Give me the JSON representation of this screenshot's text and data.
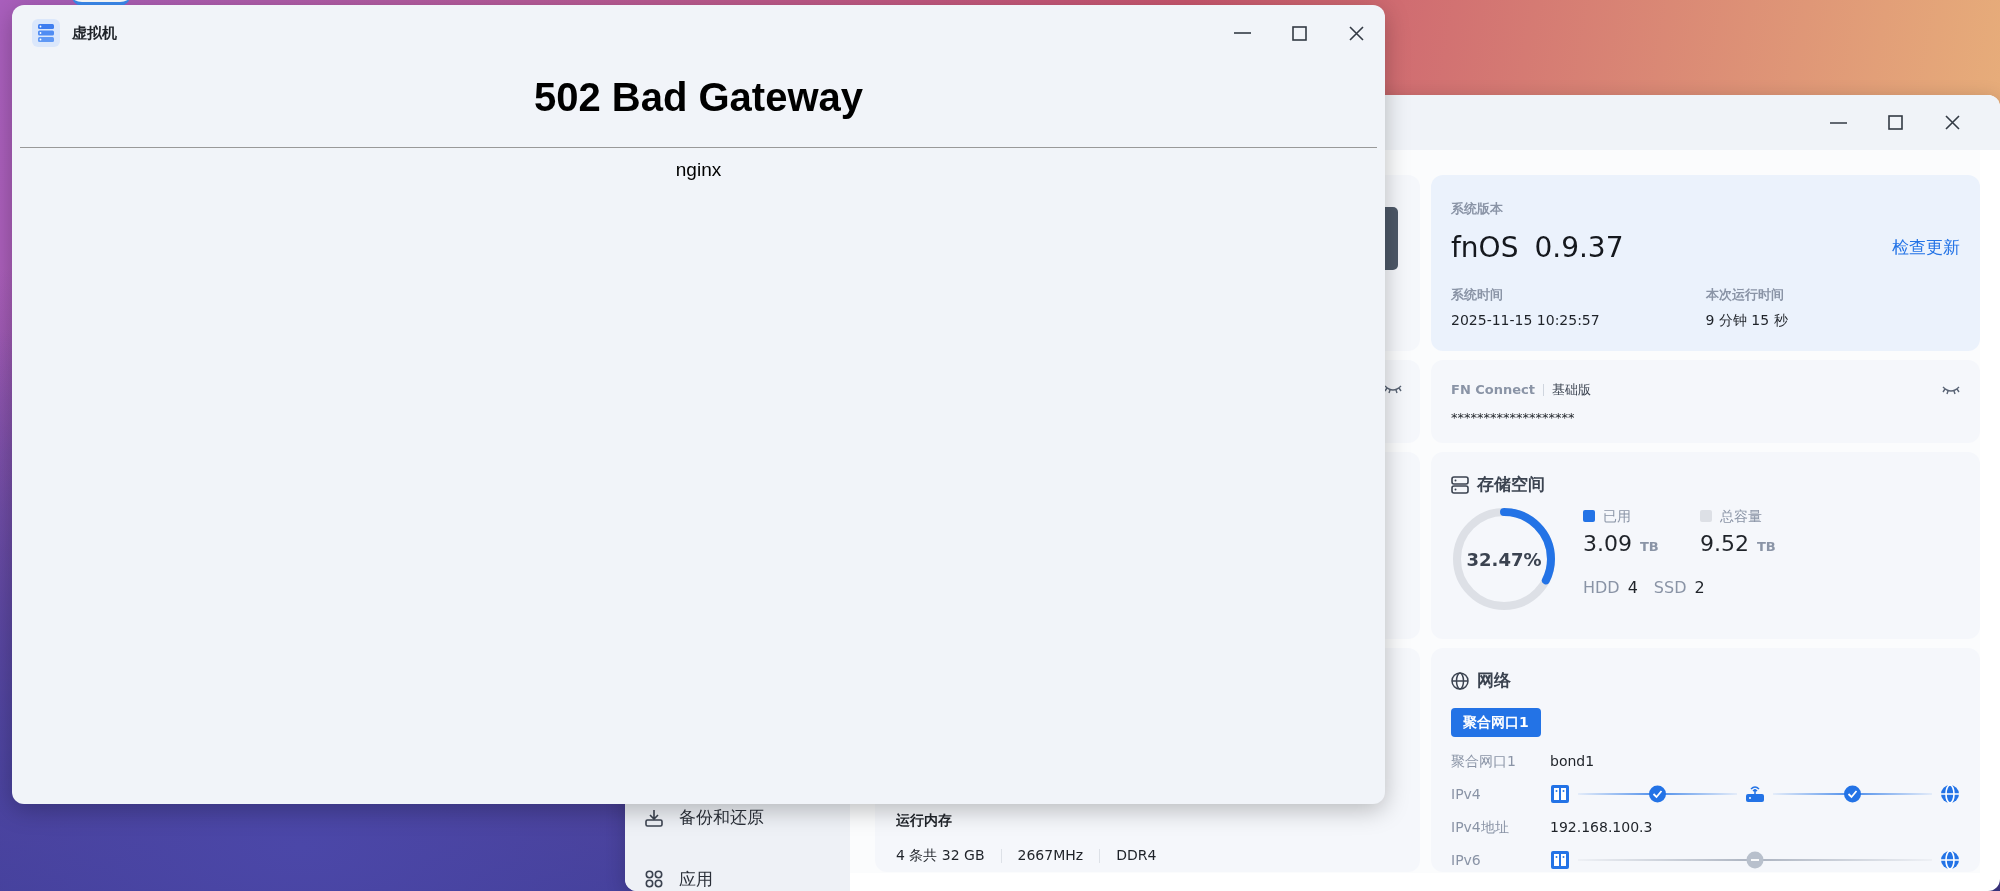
{
  "back_window": {
    "sidebar": [
      {
        "label": "备份和还原"
      },
      {
        "label": "应用"
      }
    ],
    "memory": {
      "title": "运行内存",
      "specs": [
        "4 条共 32 GB",
        "2667MHz",
        "DDR4"
      ]
    },
    "system": {
      "version_label": "系统版本",
      "os": "fnOS",
      "version": "0.9.37",
      "update_link": "检查更新",
      "time_label": "系统时间",
      "time": "2025-11-15 10:25:57",
      "uptime_label": "本次运行时间",
      "uptime": "9 分钟 15 秒"
    },
    "fn_connect": {
      "title": "FN Connect",
      "edition": "基础版",
      "masked_id": "*******************"
    },
    "storage": {
      "title": "存储空间",
      "level": 0.3247,
      "percent": "32.47%",
      "used_label": "已用",
      "used": "3.09",
      "used_unit": "TB",
      "total_label": "总容量",
      "total": "9.52",
      "total_unit": "TB",
      "disks": [
        {
          "type": "HDD",
          "count": "4"
        },
        {
          "type": "SSD",
          "count": "2"
        }
      ]
    },
    "network": {
      "title": "网络",
      "tabs": [
        {
          "label": "聚合网口1",
          "selected": true
        }
      ],
      "rows": [
        {
          "kind": "text",
          "label": "聚合网口1",
          "value": "bond1"
        },
        {
          "kind": "path",
          "label": "IPv4",
          "links": [
            {
              "ok": true
            },
            {
              "ok": true
            }
          ]
        },
        {
          "kind": "text",
          "label": "IPv4地址",
          "value": "192.168.100.3"
        },
        {
          "kind": "path",
          "label": "IPv6",
          "links": [
            {
              "ok": false
            }
          ]
        }
      ]
    }
  },
  "front_window": {
    "title": "虚拟机",
    "heading": "502 Bad Gateway",
    "server": "nginx"
  }
}
